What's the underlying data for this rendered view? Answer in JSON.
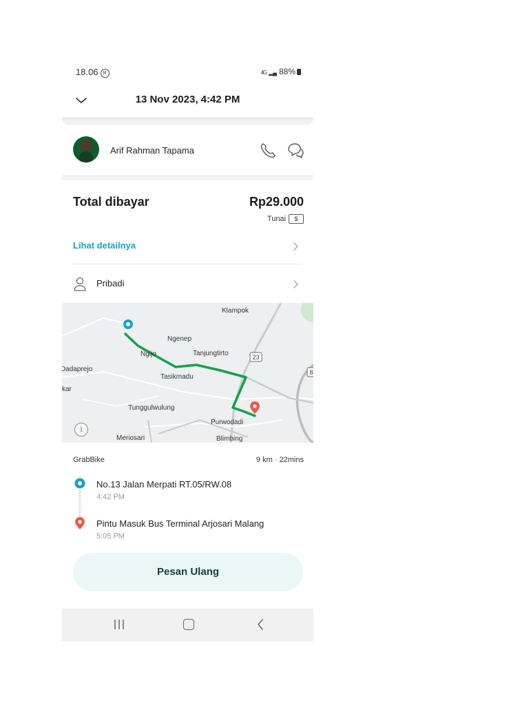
{
  "status_bar": {
    "time": "18.06",
    "time_badge": "B",
    "network": "4G",
    "battery": "88%"
  },
  "header": {
    "title": "13 Nov 2023, 4:42 PM"
  },
  "driver": {
    "name": "Arif Rahman Tapama"
  },
  "payment": {
    "total_label": "Total dibayar",
    "total_value": "Rp29.000",
    "method": "Tunai",
    "method_icon_symbol": "$"
  },
  "links": {
    "detail_label": "Lihat detailnya",
    "profile_label": "Pribadi"
  },
  "map": {
    "labels": [
      "Klampok",
      "Ngenep",
      "Ngijo",
      "Tanjungtirto",
      "Dadaprejo",
      "Tasikmadu",
      "kar",
      "Tunggulwulung",
      "Purwodadi",
      "Meriosari",
      "Blimbing"
    ],
    "road_markers": [
      "23",
      "8"
    ],
    "route_color": "#14a04a",
    "pickup_color": "#1aa0c7",
    "dropoff_color": "#ea5a4a",
    "info_symbol": "i"
  },
  "trip": {
    "service": "GrabBike",
    "meta": "9 km · 22mins",
    "pickup": {
      "address": "No.13 Jalan Merpati RT.05/RW.08",
      "time": "4:42 PM"
    },
    "dropoff": {
      "address": "Pintu Masuk Bus Terminal Arjosari Malang",
      "time": "5:05 PM"
    }
  },
  "actions": {
    "reorder_label": "Pesan Ulang"
  },
  "icons": [
    "chevron-down-icon",
    "phone-icon",
    "chat-icon",
    "cash-icon",
    "chevron-right-icon",
    "profile-icon",
    "pickup-pin-icon",
    "dropoff-pin-icon",
    "info-icon",
    "nav-recent-icon",
    "nav-home-icon",
    "nav-back-icon"
  ]
}
